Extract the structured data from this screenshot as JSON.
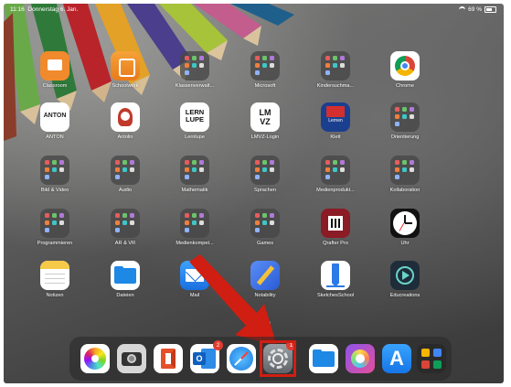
{
  "status": {
    "time": "11:16",
    "date": "Donnerstag 6. Jan.",
    "battery": "69 %"
  },
  "page_dots": {
    "count": 3,
    "active": 2
  },
  "rows": [
    [
      {
        "label": "Classroom",
        "icon": "classroom-icon"
      },
      {
        "label": "Schoolwork",
        "icon": "schoolwork-icon"
      },
      {
        "label": "Klassenverwalt...",
        "icon": "folder-icon"
      },
      {
        "label": "Microsoft",
        "icon": "folder-icon"
      },
      {
        "label": "Kindersuchma...",
        "icon": "folder-icon"
      },
      {
        "label": "Chrome",
        "icon": "chrome-icon"
      }
    ],
    [
      {
        "label": "ANTON",
        "icon": "anton-icon",
        "glyph": "ANTON"
      },
      {
        "label": "Antolin",
        "icon": "antolin-icon"
      },
      {
        "label": "Lernlupe",
        "icon": "lernlupe-icon",
        "glyph": "LERN LUPE"
      },
      {
        "label": "LMVZ-Login",
        "icon": "lmvz-icon",
        "glyph": "LM VZ"
      },
      {
        "label": "Klett",
        "icon": "klett-icon",
        "glyph": "Lernen"
      },
      {
        "label": "Orientierung",
        "icon": "folder-icon"
      }
    ],
    [
      {
        "label": "Bild & Video",
        "icon": "folder-icon"
      },
      {
        "label": "Audio",
        "icon": "folder-icon"
      },
      {
        "label": "Mathematik",
        "icon": "folder-icon"
      },
      {
        "label": "Sprachen",
        "icon": "folder-icon"
      },
      {
        "label": "Medienprodukt...",
        "icon": "folder-icon"
      },
      {
        "label": "Kollaboration",
        "icon": "folder-icon"
      }
    ],
    [
      {
        "label": "Programmieren",
        "icon": "folder-icon"
      },
      {
        "label": "AR & VR",
        "icon": "folder-icon"
      },
      {
        "label": "Medienkompet...",
        "icon": "folder-icon"
      },
      {
        "label": "Games",
        "icon": "folder-icon"
      },
      {
        "label": "Qrafter Pro",
        "icon": "qrafter-icon"
      },
      {
        "label": "Uhr",
        "icon": "clock-icon"
      }
    ],
    [
      {
        "label": "Notizen",
        "icon": "notes-icon"
      },
      {
        "label": "Dateien",
        "icon": "files-icon"
      },
      {
        "label": "Mail",
        "icon": "mail-icon"
      },
      {
        "label": "Notability",
        "icon": "notability-icon"
      },
      {
        "label": "SketchesSchool",
        "icon": "sketches-icon"
      },
      {
        "label": "Educreations",
        "icon": "educreations-icon"
      }
    ]
  ],
  "dock": [
    {
      "name": "photos-icon"
    },
    {
      "name": "camera-icon"
    },
    {
      "name": "office-icon"
    },
    {
      "name": "outlook-icon",
      "badge": "2"
    },
    {
      "name": "safari-icon"
    },
    {
      "name": "settings-icon",
      "badge": "1",
      "highlight": true
    },
    {
      "name": "files-dock-icon"
    },
    {
      "name": "imovie-icon"
    },
    {
      "name": "app-store-icon"
    },
    {
      "name": "app-library-icon"
    }
  ],
  "annotation": {
    "color": "#d01e12"
  }
}
